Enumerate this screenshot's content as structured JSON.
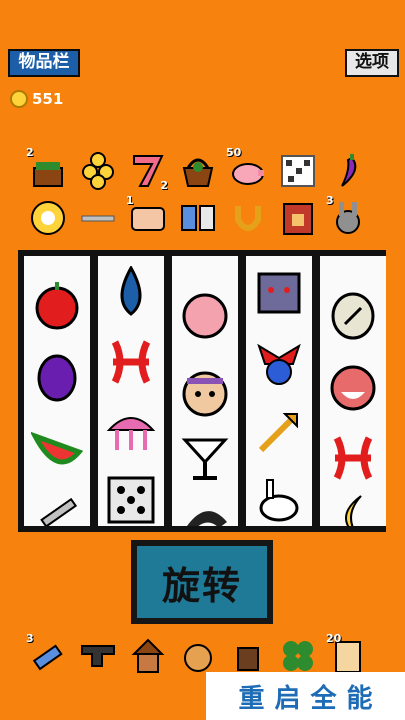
{
  "header": {
    "inventory_label": "物品栏",
    "options_label": "选项"
  },
  "coins": {
    "icon": "coin-icon",
    "amount": "551"
  },
  "items_row1": [
    {
      "icon": "planter-icon",
      "count": "2"
    },
    {
      "icon": "coins-stack-icon",
      "count": ""
    },
    {
      "icon": "lucky-seven-icon",
      "count": "2"
    },
    {
      "icon": "basket-icon",
      "count": ""
    },
    {
      "icon": "pig-icon",
      "count": "50"
    },
    {
      "icon": "static-tv-icon",
      "count": ""
    },
    {
      "icon": "chili-icon",
      "count": ""
    }
  ],
  "items_row2": [
    {
      "icon": "billiard-ball-icon",
      "count": ""
    },
    {
      "icon": "pipe-icon",
      "count": ""
    },
    {
      "icon": "bandage-icon",
      "count": "1"
    },
    {
      "icon": "dice-bow-icon",
      "count": ""
    },
    {
      "icon": "horseshoe-icon",
      "count": ""
    },
    {
      "icon": "shrine-icon",
      "count": ""
    },
    {
      "icon": "rabbit-head-icon",
      "count": "3"
    }
  ],
  "reels": [
    [
      "apple-icon",
      "grape-icon",
      "watermelon-icon",
      "sword-icon"
    ],
    [
      "water-drop-icon",
      "pisces-icon",
      "jellyfish-icon",
      "dice-icon"
    ],
    [
      "peach-icon",
      "face-icon",
      "cocktail-icon",
      "dolphin-icon"
    ],
    [
      "mouse-icon",
      "jester-icon",
      "arrow-icon",
      "rabbit-icon"
    ],
    [
      "ellipse-stone-icon",
      "laughing-face-icon",
      "pisces-icon",
      "moon-icon"
    ]
  ],
  "spin": {
    "label": "旋转"
  },
  "bottom_items": [
    {
      "icon": "flashlight-icon",
      "count": "3"
    },
    {
      "icon": "anvil-icon",
      "count": ""
    },
    {
      "icon": "birdhouse-icon",
      "count": ""
    },
    {
      "icon": "cat-icon",
      "count": ""
    },
    {
      "icon": "goat-icon",
      "count": ""
    },
    {
      "icon": "clover-icon",
      "count": ""
    },
    {
      "icon": "scroll-icon",
      "count": "20"
    }
  ],
  "watermark": {
    "chars": [
      "重",
      "启",
      "全",
      "能"
    ]
  }
}
